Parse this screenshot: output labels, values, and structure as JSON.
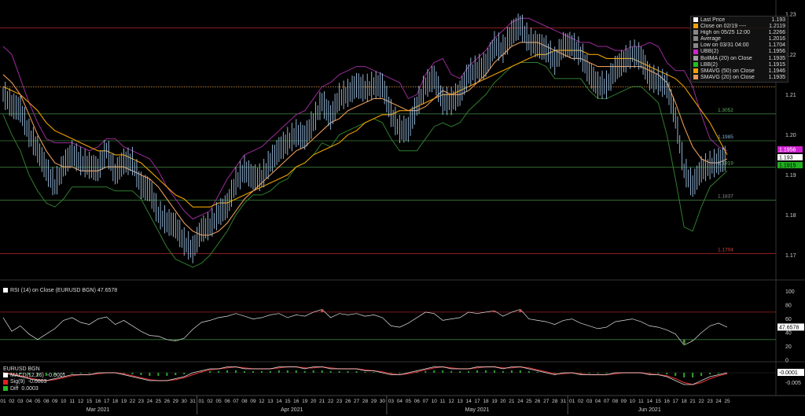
{
  "colors": {
    "price": "#9fc3e6",
    "ubb": "#9b2c9b",
    "lbb": "#2f7d2f",
    "sma50": "#f0a000",
    "sma20": "#e89a55",
    "level_red": "#a02020",
    "level_green": "#3a7a3a",
    "rsi_line": "#e0e0e0",
    "grid": "#2a2a2a"
  },
  "legend": [
    {
      "label": "Last Price",
      "value": "1.193",
      "color": "#ffffff"
    },
    {
      "label": "Close on 02/19 ----",
      "value": "1.2119",
      "color": "#f0a000"
    },
    {
      "label": "High on 05/25 12:00",
      "value": "1.2266",
      "color": "#888888"
    },
    {
      "label": "Average",
      "value": "1.2016",
      "color": "#888888"
    },
    {
      "label": "Low on 03/31 04:00",
      "value": "1.1704",
      "color": "#888888"
    },
    {
      "label": "UBB(2)",
      "value": "1.1956",
      "color": "#d020d0"
    },
    {
      "label": "BollMA (20) on Close",
      "value": "1.1935",
      "color": "#a0a0a0"
    },
    {
      "label": "LBB(2)",
      "value": "1.1915",
      "color": "#20c020"
    },
    {
      "label": "SMAVG (50) on Close",
      "value": "1.1946",
      "color": "#f0a000"
    },
    {
      "label": "SMAVG (20) on Close",
      "value": "1.1935",
      "color": "#e89a55"
    }
  ],
  "level_labels": [
    "1.3052",
    "1.1985",
    "1.1919",
    "1.1837",
    "1.1704"
  ],
  "y_ticks": [
    "1.23",
    "1.22",
    "1.21",
    "1.20",
    "1.19",
    "1.18",
    "1.17"
  ],
  "right_tags": {
    "ubb": "1.1956",
    "last": "1.193",
    "lbb": "1.1915"
  },
  "rsi": {
    "title": "RSI (14)  on Close (EURUSD BGN) 47.6578",
    "value_tag": "47.6578",
    "ticks": [
      "100",
      "80",
      "60",
      "40",
      "20",
      "0"
    ]
  },
  "macd": {
    "title": "EURUSD BGN",
    "rows": [
      {
        "label": "MACD(12,26)",
        "value": "-0.0001",
        "color": "#ffffff"
      },
      {
        "label": "Sig(9)",
        "value": "-0.0003",
        "color": "#e02020"
      },
      {
        "label": "Diff",
        "value": "0.0003",
        "color": "#20c020"
      }
    ],
    "value_tag": "-0.0001",
    "ticks": [
      "0",
      "-0.005"
    ]
  },
  "x_days": [
    "01",
    "02",
    "03",
    "04",
    "05",
    "08",
    "09",
    "10",
    "11",
    "12",
    "15",
    "16",
    "17",
    "18",
    "19",
    "22",
    "23",
    "24",
    "25",
    "26",
    "29",
    "30",
    "31",
    "01",
    "02",
    "05",
    "06",
    "07",
    "08",
    "09",
    "12",
    "13",
    "14",
    "15",
    "16",
    "19",
    "20",
    "21",
    "22",
    "23",
    "26",
    "27",
    "28",
    "29",
    "30",
    "03",
    "04",
    "05",
    "06",
    "07",
    "10",
    "11",
    "12",
    "13",
    "14",
    "17",
    "18",
    "19",
    "20",
    "21",
    "24",
    "25",
    "26",
    "27",
    "28",
    "31",
    "01",
    "02",
    "03",
    "04",
    "07",
    "08",
    "09",
    "10",
    "11",
    "14",
    "15",
    "16",
    "17",
    "18",
    "21",
    "22",
    "23",
    "24",
    "25"
  ],
  "x_months": [
    "Mar 2021",
    "Apr 2021",
    "May 2021",
    "Jun 2021"
  ],
  "chart_data": {
    "type": "line",
    "title": "EURUSD BGN",
    "x_range": [
      "2021-03-01",
      "2021-06-25"
    ],
    "ylim": [
      1.165,
      1.232
    ],
    "grid": false,
    "legend_position": "top-right",
    "horizontal_levels": [
      {
        "value": 1.2266,
        "color": "red"
      },
      {
        "value": 1.2119,
        "color": "orange-dotted"
      },
      {
        "value": 1.2052,
        "color": "green"
      },
      {
        "value": 1.1985,
        "color": "green"
      },
      {
        "value": 1.1919,
        "color": "green"
      },
      {
        "value": 1.1837,
        "color": "green"
      },
      {
        "value": 1.1704,
        "color": "red"
      }
    ],
    "series": [
      {
        "name": "Last Price",
        "values": [
          1.21,
          1.207,
          1.206,
          1.2,
          1.196,
          1.191,
          1.187,
          1.192,
          1.195,
          1.193,
          1.192,
          1.191,
          1.196,
          1.19,
          1.193,
          1.193,
          1.187,
          1.186,
          1.18,
          1.178,
          1.177,
          1.173,
          1.171,
          1.176,
          1.177,
          1.18,
          1.182,
          1.188,
          1.191,
          1.189,
          1.189,
          1.193,
          1.196,
          1.198,
          1.2,
          1.199,
          1.203,
          1.208,
          1.204,
          1.209,
          1.21,
          1.212,
          1.211,
          1.212,
          1.212,
          1.205,
          1.201,
          1.201,
          1.207,
          1.212,
          1.214,
          1.208,
          1.208,
          1.21,
          1.215,
          1.216,
          1.217,
          1.222,
          1.221,
          1.225,
          1.227,
          1.223,
          1.222,
          1.221,
          1.218,
          1.222,
          1.222,
          1.22,
          1.215,
          1.212,
          1.212,
          1.216,
          1.218,
          1.22,
          1.219,
          1.214,
          1.213,
          1.212,
          1.204,
          1.191,
          1.187,
          1.191,
          1.192,
          1.193,
          1.194
        ]
      },
      {
        "name": "UBB(2)",
        "values": [
          1.222,
          1.22,
          1.214,
          1.208,
          1.203,
          1.199,
          1.198,
          1.198,
          1.198,
          1.197,
          1.196,
          1.197,
          1.199,
          1.199,
          1.197,
          1.196,
          1.195,
          1.194,
          1.191,
          1.187,
          1.184,
          1.181,
          1.179,
          1.18,
          1.181,
          1.185,
          1.189,
          1.192,
          1.195,
          1.196,
          1.197,
          1.199,
          1.201,
          1.203,
          1.205,
          1.206,
          1.209,
          1.212,
          1.213,
          1.215,
          1.216,
          1.217,
          1.217,
          1.216,
          1.215,
          1.214,
          1.213,
          1.209,
          1.21,
          1.215,
          1.218,
          1.219,
          1.215,
          1.214,
          1.217,
          1.219,
          1.221,
          1.224,
          1.226,
          1.228,
          1.229,
          1.229,
          1.228,
          1.227,
          1.226,
          1.225,
          1.224,
          1.223,
          1.223,
          1.222,
          1.222,
          1.221,
          1.221,
          1.222,
          1.222,
          1.223,
          1.222,
          1.218,
          1.216,
          1.216,
          1.212,
          1.205,
          1.199,
          1.197,
          1.196
        ]
      },
      {
        "name": "LBB(2)",
        "values": [
          1.205,
          1.2,
          1.196,
          1.19,
          1.186,
          1.183,
          1.182,
          1.184,
          1.187,
          1.187,
          1.187,
          1.187,
          1.187,
          1.186,
          1.186,
          1.186,
          1.184,
          1.18,
          1.176,
          1.172,
          1.169,
          1.168,
          1.167,
          1.168,
          1.17,
          1.173,
          1.176,
          1.18,
          1.183,
          1.185,
          1.185,
          1.186,
          1.188,
          1.189,
          1.192,
          1.193,
          1.195,
          1.198,
          1.197,
          1.2,
          1.201,
          1.202,
          1.203,
          1.204,
          1.203,
          1.199,
          1.196,
          1.196,
          1.196,
          1.199,
          1.202,
          1.203,
          1.202,
          1.203,
          1.206,
          1.208,
          1.21,
          1.213,
          1.215,
          1.217,
          1.218,
          1.218,
          1.218,
          1.217,
          1.214,
          1.214,
          1.214,
          1.214,
          1.211,
          1.209,
          1.209,
          1.21,
          1.211,
          1.212,
          1.212,
          1.21,
          1.208,
          1.2,
          1.189,
          1.177,
          1.176,
          1.182,
          1.187,
          1.189,
          1.191
        ]
      },
      {
        "name": "SMAVG (50) on Close",
        "values": [
          1.212,
          1.211,
          1.21,
          1.208,
          1.206,
          1.203,
          1.201,
          1.2,
          1.199,
          1.198,
          1.197,
          1.196,
          1.196,
          1.195,
          1.195,
          1.194,
          1.193,
          1.191,
          1.189,
          1.187,
          1.185,
          1.184,
          1.182,
          1.182,
          1.182,
          1.183,
          1.183,
          1.184,
          1.185,
          1.186,
          1.187,
          1.188,
          1.189,
          1.19,
          1.192,
          1.193,
          1.195,
          1.196,
          1.197,
          1.198,
          1.2,
          1.201,
          1.203,
          1.204,
          1.205,
          1.205,
          1.206,
          1.206,
          1.207,
          1.208,
          1.209,
          1.21,
          1.21,
          1.211,
          1.212,
          1.213,
          1.214,
          1.215,
          1.216,
          1.217,
          1.218,
          1.219,
          1.22,
          1.22,
          1.221,
          1.221,
          1.221,
          1.221,
          1.22,
          1.22,
          1.219,
          1.219,
          1.219,
          1.219,
          1.218,
          1.217,
          1.216,
          1.215,
          1.214,
          1.212,
          1.209,
          1.206,
          1.203,
          1.199,
          1.195
        ]
      },
      {
        "name": "SMAVG (20) on Close",
        "values": [
          1.215,
          1.213,
          1.21,
          1.205,
          1.2,
          1.196,
          1.193,
          1.192,
          1.192,
          1.191,
          1.191,
          1.191,
          1.192,
          1.192,
          1.192,
          1.191,
          1.19,
          1.189,
          1.187,
          1.184,
          1.181,
          1.178,
          1.176,
          1.175,
          1.175,
          1.176,
          1.178,
          1.181,
          1.184,
          1.186,
          1.188,
          1.19,
          1.192,
          1.194,
          1.196,
          1.197,
          1.199,
          1.201,
          1.203,
          1.204,
          1.206,
          1.207,
          1.208,
          1.209,
          1.209,
          1.208,
          1.207,
          1.206,
          1.206,
          1.207,
          1.209,
          1.211,
          1.21,
          1.21,
          1.211,
          1.213,
          1.215,
          1.218,
          1.22,
          1.222,
          1.223,
          1.223,
          1.223,
          1.222,
          1.221,
          1.22,
          1.219,
          1.219,
          1.218,
          1.217,
          1.217,
          1.217,
          1.217,
          1.217,
          1.217,
          1.216,
          1.215,
          1.213,
          1.208,
          1.202,
          1.197,
          1.194,
          1.193,
          1.193,
          1.194
        ]
      }
    ],
    "rsi_values": [
      62,
      42,
      50,
      38,
      30,
      38,
      46,
      58,
      62,
      55,
      52,
      60,
      63,
      52,
      58,
      50,
      42,
      36,
      35,
      30,
      28,
      32,
      45,
      55,
      58,
      62,
      64,
      68,
      64,
      60,
      62,
      66,
      68,
      62,
      66,
      64,
      70,
      74,
      62,
      68,
      66,
      68,
      64,
      66,
      62,
      50,
      48,
      54,
      62,
      70,
      68,
      58,
      60,
      62,
      70,
      68,
      70,
      72,
      64,
      70,
      74,
      60,
      58,
      56,
      52,
      58,
      60,
      54,
      50,
      46,
      48,
      56,
      58,
      60,
      56,
      50,
      48,
      44,
      38,
      22,
      28,
      40,
      50,
      54,
      48
    ],
    "macd_values": [
      0.0,
      -0.001,
      -0.002,
      -0.003,
      -0.004,
      -0.004,
      -0.003,
      -0.002,
      -0.001,
      -0.001,
      -0.001,
      0.0,
      0.0,
      0.0,
      -0.001,
      -0.002,
      -0.003,
      -0.004,
      -0.004,
      -0.004,
      -0.003,
      -0.002,
      0.0,
      0.001,
      0.002,
      0.002,
      0.003,
      0.003,
      0.002,
      0.002,
      0.002,
      0.002,
      0.003,
      0.003,
      0.003,
      0.002,
      0.003,
      0.003,
      0.002,
      0.002,
      0.002,
      0.002,
      0.001,
      0.001,
      0.0,
      -0.001,
      -0.001,
      0.0,
      0.001,
      0.002,
      0.003,
      0.003,
      0.002,
      0.002,
      0.002,
      0.003,
      0.003,
      0.003,
      0.002,
      0.003,
      0.003,
      0.002,
      0.001,
      0.0,
      -0.001,
      0.0,
      0.0,
      -0.001,
      -0.001,
      -0.001,
      -0.001,
      0.0,
      0.0,
      0.0,
      0.0,
      -0.001,
      -0.001,
      -0.002,
      -0.004,
      -0.006,
      -0.006,
      -0.004,
      -0.002,
      -0.001,
      0.0
    ]
  }
}
